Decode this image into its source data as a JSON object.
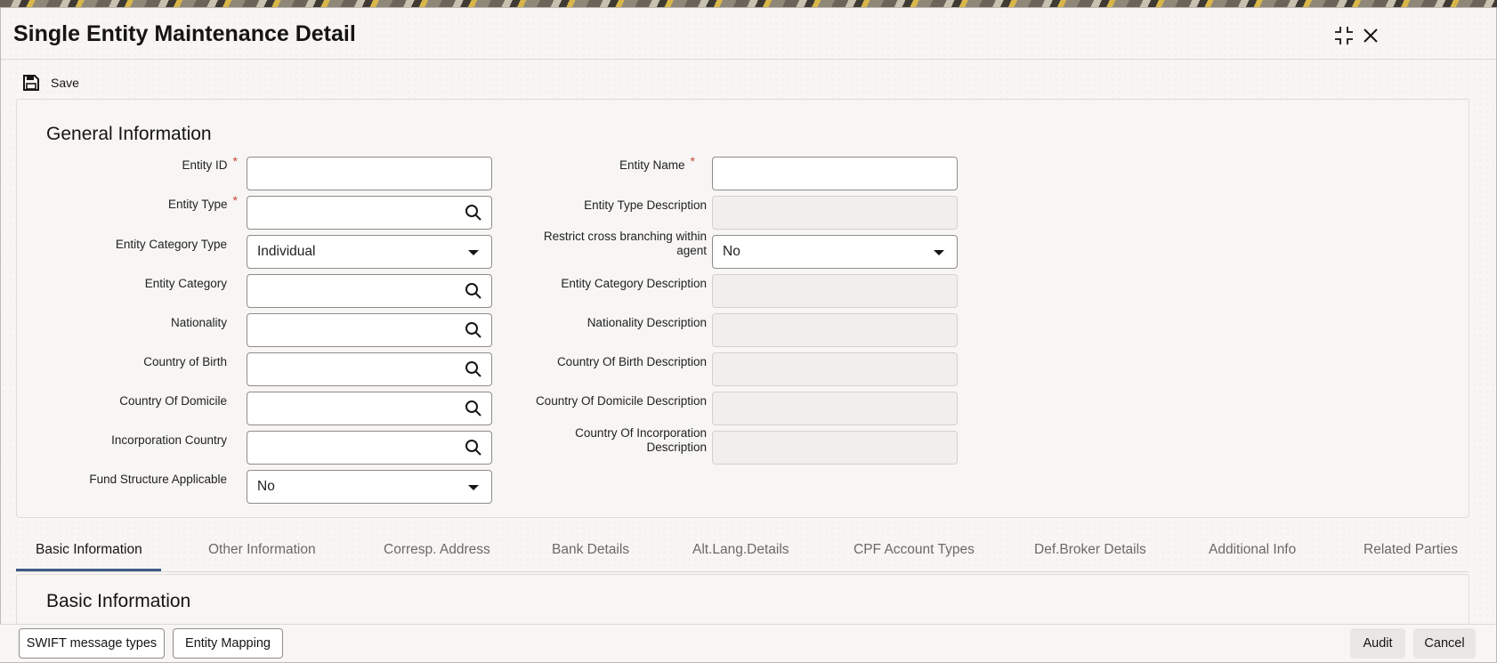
{
  "window": {
    "title": "Single Entity Maintenance Detail"
  },
  "toolbar": {
    "save_label": "Save"
  },
  "general": {
    "heading": "General Information",
    "entity_id": {
      "label": "Entity ID",
      "value": ""
    },
    "entity_name": {
      "label": "Entity Name",
      "value": ""
    },
    "entity_type": {
      "label": "Entity Type",
      "value": ""
    },
    "entity_type_description": {
      "label": "Entity Type Description",
      "value": ""
    },
    "entity_category_type": {
      "label": "Entity Category Type",
      "value": "Individual"
    },
    "restrict_cross_branching": {
      "label_line1": "Restrict cross branching within",
      "label_line2": "agent",
      "value": "No"
    },
    "entity_category": {
      "label": "Entity Category",
      "value": ""
    },
    "entity_category_description": {
      "label": "Entity Category Description",
      "value": ""
    },
    "nationality": {
      "label": "Nationality",
      "value": ""
    },
    "nationality_description": {
      "label": "Nationality Description",
      "value": ""
    },
    "country_of_birth": {
      "label": "Country of Birth",
      "value": ""
    },
    "country_of_birth_description": {
      "label": "Country Of Birth Description",
      "value": ""
    },
    "country_of_domicile": {
      "label": "Country Of Domicile",
      "value": ""
    },
    "country_of_domicile_description": {
      "label": "Country Of Domicile Description",
      "value": ""
    },
    "incorporation_country": {
      "label": "Incorporation Country",
      "value": ""
    },
    "country_of_incorporation_description": {
      "label_line1": "Country Of Incorporation",
      "label_line2": "Description",
      "value": ""
    },
    "fund_structure_applicable": {
      "label": "Fund Structure Applicable",
      "value": "No"
    }
  },
  "tabs": [
    {
      "label": "Basic Information"
    },
    {
      "label": "Other Information"
    },
    {
      "label": "Corresp. Address"
    },
    {
      "label": "Bank Details"
    },
    {
      "label": "Alt.Lang.Details"
    },
    {
      "label": "CPF Account Types"
    },
    {
      "label": "Def.Broker Details"
    },
    {
      "label": "Additional Info"
    },
    {
      "label": "Related Parties"
    }
  ],
  "basic": {
    "heading": "Basic Information"
  },
  "footer": {
    "swift_label": "SWIFT message types",
    "entity_mapping_label": "Entity Mapping",
    "audit_label": "Audit",
    "cancel_label": "Cancel"
  },
  "colors": {
    "accent": "#3e5a84",
    "required": "#c74634"
  }
}
